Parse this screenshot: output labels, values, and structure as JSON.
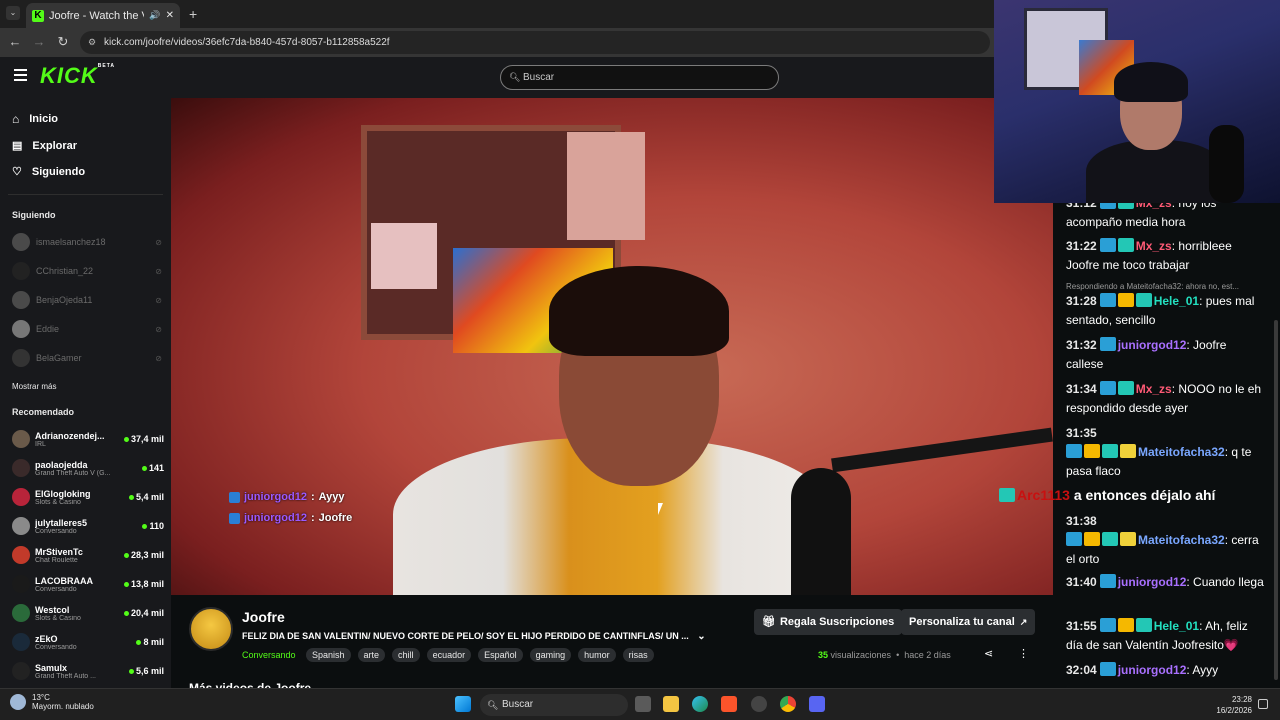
{
  "browser": {
    "tab_title": "Joofre - Watch the VOD on",
    "url": "kick.com/joofre/videos/36efc7da-b840-457d-8057-b112858a522f"
  },
  "header": {
    "logo": "KICK",
    "logo_badge": "BETA",
    "search_placeholder": "Buscar"
  },
  "sidebar": {
    "nav": [
      {
        "label": "Inicio",
        "icon": "home-icon"
      },
      {
        "label": "Explorar",
        "icon": "compass-icon"
      },
      {
        "label": "Siguiendo",
        "icon": "heart-icon"
      }
    ],
    "following_title": "Siguiendo",
    "following": [
      {
        "name": "ismaelsanchez18"
      },
      {
        "name": "CChristian_22"
      },
      {
        "name": "BenjaOjeda11"
      },
      {
        "name": "Eddie"
      },
      {
        "name": "BelaGamer"
      }
    ],
    "show_more": "Mostrar más",
    "recommended_title": "Recomendado",
    "recommended": [
      {
        "name": "Adrianozendej...",
        "category": "IRL",
        "viewers": "37,4 mil"
      },
      {
        "name": "paolaojedda",
        "category": "Grand Theft Auto V (G...",
        "viewers": "141"
      },
      {
        "name": "ElGlogloking",
        "category": "Slots & Casino",
        "viewers": "5,4 mil"
      },
      {
        "name": "julytalleres5",
        "category": "Conversando",
        "viewers": "110"
      },
      {
        "name": "MrStivenTc",
        "category": "Chat Roulette",
        "viewers": "28,3 mil"
      },
      {
        "name": "LACOBRAAA",
        "category": "Conversando",
        "viewers": "13,8 mil"
      },
      {
        "name": "Westcol",
        "category": "Slots & Casino",
        "viewers": "20,4 mil"
      },
      {
        "name": "zEkO",
        "category": "Conversando",
        "viewers": "8 mil"
      },
      {
        "name": "Samulx",
        "category": "Grand Theft Auto ...",
        "viewers": "5,6 mil"
      }
    ]
  },
  "video_overlay": {
    "messages": [
      {
        "user": "juniorgod12",
        "sep": " : ",
        "text": "Ayyy"
      },
      {
        "user": "juniorgod12",
        "sep": " : ",
        "text": "Joofre"
      }
    ],
    "floating_user": "Arc1113",
    "floating_text": "a entonces déjalo ahí"
  },
  "video_info": {
    "channel": "Joofre",
    "title": "FELIZ DIA DE SAN VALENTIN/ NUEVO CORTE DE PELO/ SOY EL HIJO PERDIDO DE CANTINFLAS/ UN ...",
    "category": "Conversando",
    "tags": [
      "Spanish",
      "arte",
      "chill",
      "ecuador",
      "Español",
      "gaming",
      "humor",
      "risas"
    ],
    "gift_button": "Regala Suscripciones",
    "customize_button": "Personaliza tu canal",
    "views_count": "35",
    "views_label": "visualizaciones",
    "date": "hace 2 días",
    "more_videos": "Más videos de Joofre"
  },
  "chat": {
    "messages": [
      {
        "time": "31:12",
        "user": "Mx_zs",
        "color": "#ff5a76",
        "badges": [
          "blue",
          "teal"
        ],
        "text": ": hoy los acompaño media hora"
      },
      {
        "time": "31:22",
        "user": "Mx_zs",
        "color": "#ff5a76",
        "badges": [
          "blue",
          "teal"
        ],
        "text": ": horribleee Joofre me toco trabajar"
      },
      {
        "time": "31:28",
        "user": "Hele_01",
        "color": "#23e0c0",
        "badges": [
          "blue",
          "gold",
          "teal"
        ],
        "text": ": pues mal sentado, sencillo",
        "reply": "Respondiendo a Mateitofacha32: ahora no, est..."
      },
      {
        "time": "31:32",
        "user": "juniorgod12",
        "color": "#a970ff",
        "badges": [
          "blue"
        ],
        "text": ": Joofre callese"
      },
      {
        "time": "31:34",
        "user": "Mx_zs",
        "color": "#ff5a76",
        "badges": [
          "blue",
          "teal"
        ],
        "text": ": NOOO no le eh respondido desde ayer"
      },
      {
        "time": "31:35",
        "user": "Mateitofacha32",
        "color": "#7aa7ff",
        "badges": [
          "blue",
          "gold",
          "teal",
          "yellow"
        ],
        "text": ": q te pasa flaco"
      },
      {
        "time": "31:38",
        "user": "Mateitofacha32",
        "color": "#7aa7ff",
        "badges": [
          "blue",
          "gold",
          "teal",
          "yellow"
        ],
        "text": ": cerra el orto"
      },
      {
        "time": "31:40",
        "user": "juniorgod12",
        "color": "#a970ff",
        "badges": [
          "blue"
        ],
        "text": ": Cuando llega"
      },
      {
        "time": "31:55",
        "user": "Hele_01",
        "color": "#23e0c0",
        "badges": [
          "blue",
          "gold",
          "teal"
        ],
        "text": ": Ah, feliz día de san Valentín Joofresito💗"
      },
      {
        "time": "32:04",
        "user": "juniorgod12",
        "color": "#a970ff",
        "badges": [
          "blue"
        ],
        "text": ": Ayyy"
      }
    ]
  },
  "taskbar": {
    "temp": "13°C",
    "weather": "Mayorm. nublado",
    "search": "Buscar",
    "time": "23:28",
    "date": "16/2/2026"
  }
}
